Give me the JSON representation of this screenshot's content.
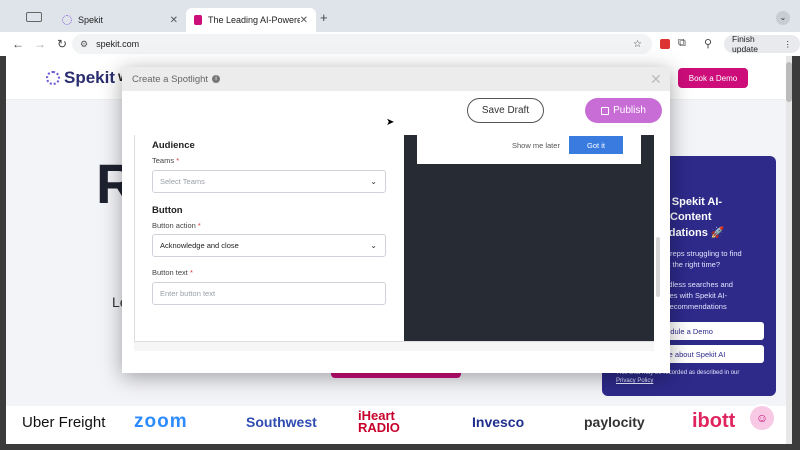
{
  "browser": {
    "tabs": [
      {
        "label": "Spekit"
      },
      {
        "label": "The Leading AI-Powered Sal"
      }
    ],
    "new_tab": "+",
    "url": "spekit.com",
    "finish_update": "Finish update"
  },
  "site": {
    "logo": "Spekit",
    "nav_letter": "W",
    "book_demo": "Book a Demo",
    "hero_letter": "R",
    "lead_text": "Le",
    "promo": {
      "line1": "g Spekit AI-",
      "line2": "Content",
      "line3": "ndations 🚀",
      "body1": "es reps struggling to find",
      "body2": "t at the right time?",
      "body3": "endless searches and",
      "body4": "nities with Spekit AI-",
      "body5": "t Recommendations",
      "btn1": "hedule a Demo",
      "btn2": "ore about Spekit AI",
      "footnote": "This chat may be recorded as described in our",
      "privacy": "Privacy Policy"
    },
    "brands": [
      "Uber Freight",
      "zoom",
      "Southwest",
      "iHeart RADIO",
      "Invesco",
      "paylocity",
      "ibott"
    ]
  },
  "modal": {
    "title": "Create a Spotlight",
    "save_draft": "Save Draft",
    "publish": "Publish",
    "audience": {
      "heading": "Audience",
      "teams_label": "Teams",
      "teams_placeholder": "Select Teams"
    },
    "button": {
      "heading": "Button",
      "action_label": "Button action",
      "action_value": "Acknowledge and close",
      "text_label": "Button text",
      "text_placeholder": "Enter button text"
    },
    "required_mark": "*",
    "preview": {
      "show_later": "Show me later",
      "got_it": "Got it"
    }
  },
  "colors": {
    "brand_pink": "#cc0d7a",
    "publish_purple": "#c86dd6",
    "promo_blue": "#2d2a8a",
    "got_it_blue": "#3a7be0"
  }
}
